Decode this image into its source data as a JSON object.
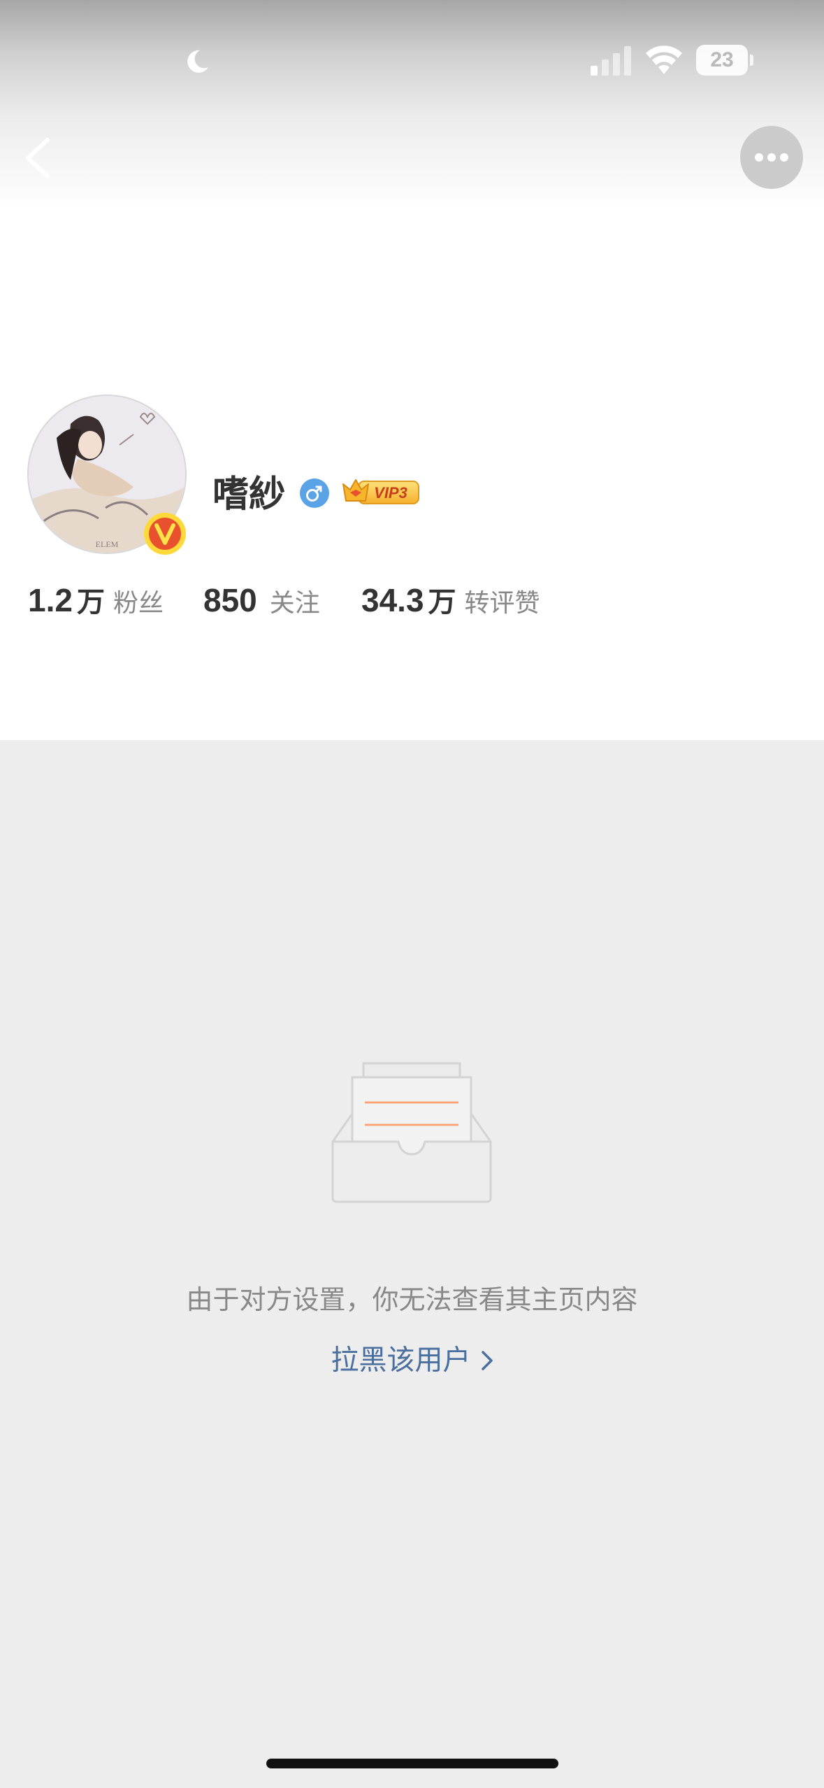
{
  "status_bar": {
    "battery_level": "23",
    "icons": [
      "moon-icon",
      "cellular-signal-icon",
      "wifi-icon",
      "battery-icon"
    ]
  },
  "nav": {
    "back_icon": "chevron-left-icon",
    "more_icon": "ellipsis-icon"
  },
  "profile": {
    "name": "嗜紗",
    "gender_icon": "male-symbol-icon",
    "gender_color": "#5aa3e6",
    "vip_label": "VIP3",
    "avatar_text": "ELEM",
    "verified_badge_color": "#e8502e",
    "stats": [
      {
        "value": "1.2",
        "unit": "万",
        "label": "粉丝"
      },
      {
        "value": "850",
        "unit": "",
        "label": "关注"
      },
      {
        "value": "34.3",
        "unit": "万",
        "label": "转评赞"
      }
    ]
  },
  "empty_state": {
    "icon": "empty-inbox-icon",
    "message": "由于对方设置，你无法查看其主页内容",
    "block_link_label": "拉黑该用户",
    "block_link_color": "#4a6f9e"
  },
  "colors": {
    "background": "#ededed",
    "card": "#ffffff",
    "accent_orange": "#f59a6a"
  }
}
